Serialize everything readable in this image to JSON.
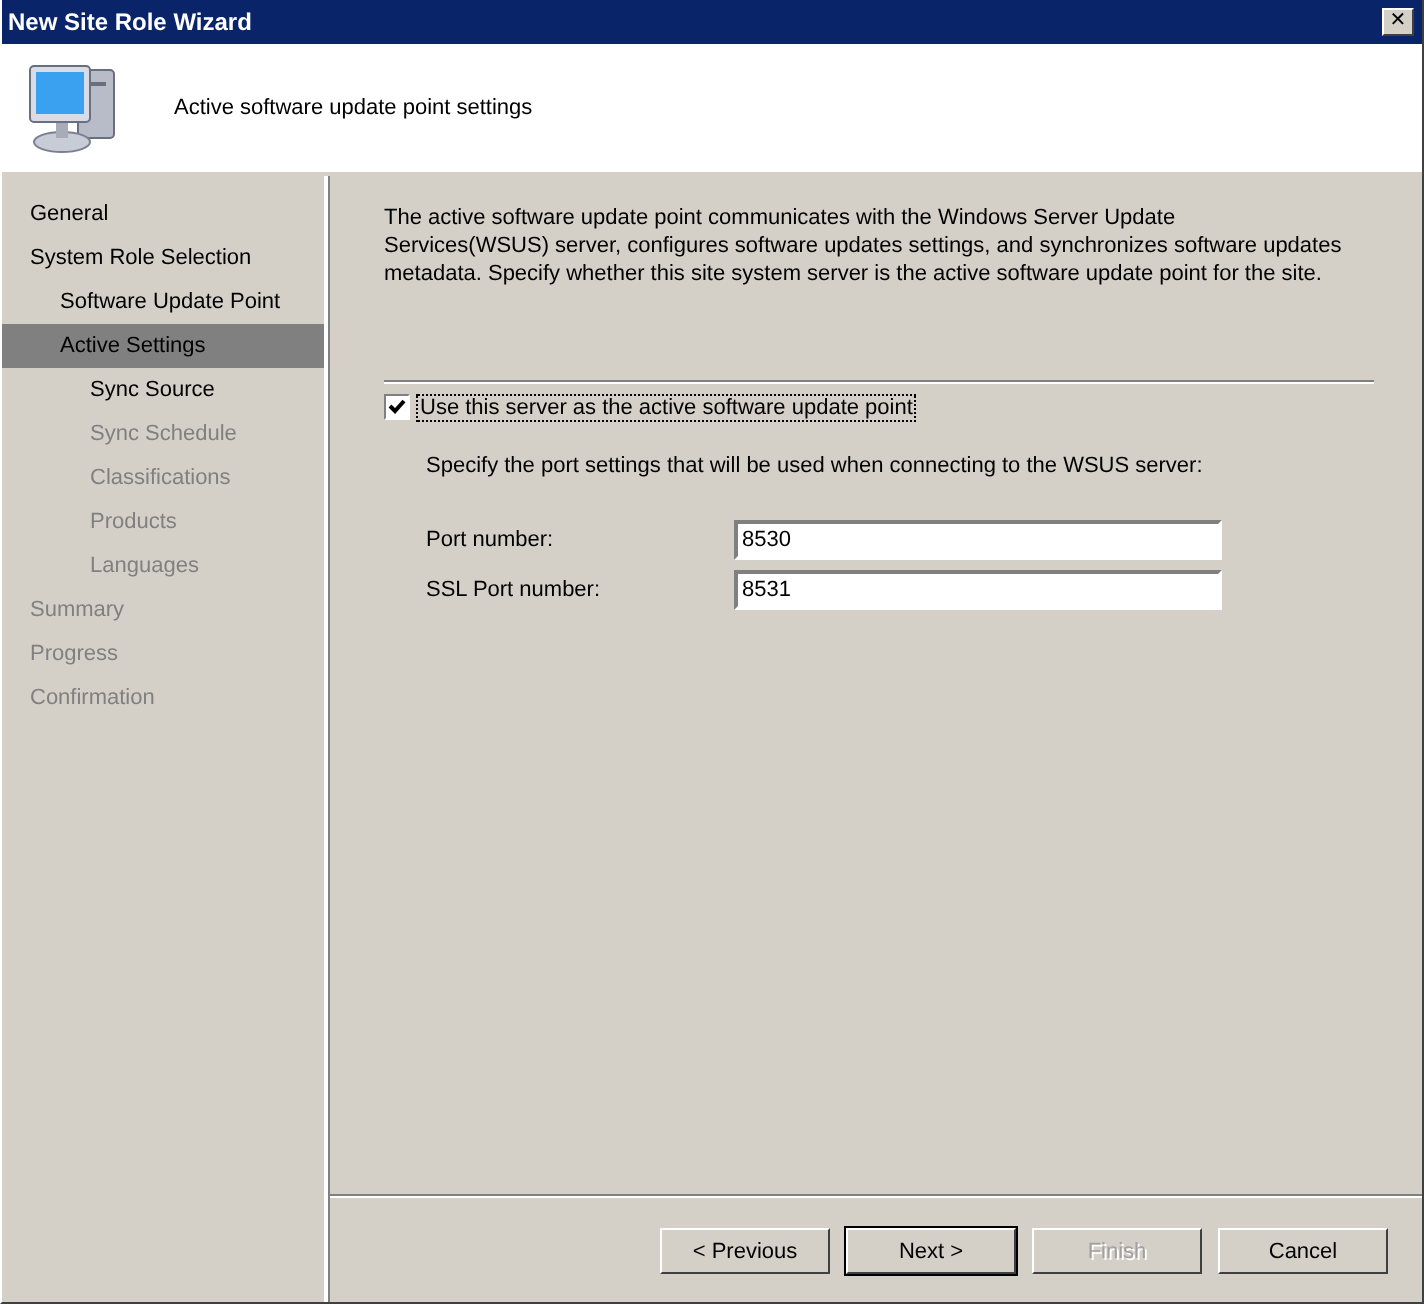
{
  "window": {
    "title": "New Site Role Wizard",
    "close": "✕"
  },
  "header": {
    "title": "Active software update point settings"
  },
  "sidebar": {
    "items": [
      {
        "label": "General",
        "disabled": false,
        "selected": false
      },
      {
        "label": "System Role Selection",
        "disabled": false,
        "selected": false,
        "children": [
          {
            "label": "Software Update Point",
            "disabled": false,
            "selected": false
          },
          {
            "label": "Active Settings",
            "disabled": false,
            "selected": true,
            "children": [
              {
                "label": "Sync Source",
                "disabled": false,
                "selected": false
              },
              {
                "label": "Sync Schedule",
                "disabled": true,
                "selected": false
              },
              {
                "label": "Classifications",
                "disabled": true,
                "selected": false
              },
              {
                "label": "Products",
                "disabled": true,
                "selected": false
              },
              {
                "label": "Languages",
                "disabled": true,
                "selected": false
              }
            ]
          }
        ]
      },
      {
        "label": "Summary",
        "disabled": true,
        "selected": false
      },
      {
        "label": "Progress",
        "disabled": true,
        "selected": false
      },
      {
        "label": "Confirmation",
        "disabled": true,
        "selected": false
      }
    ]
  },
  "content": {
    "description": "The active software update point communicates with the Windows Server Update Services(WSUS) server, configures software updates settings, and synchronizes software updates metadata. Specify whether this site system server is the active software update point for the site.",
    "checkbox": {
      "label": "Use this server as the active software update point",
      "checked": true
    },
    "port_hint": "Specify the port settings that will be used when connecting to the WSUS server:",
    "fields": [
      {
        "label": "Port number:",
        "value": "8530"
      },
      {
        "label": "SSL Port number:",
        "value": "8531"
      }
    ]
  },
  "buttons": [
    {
      "label": "< Previous",
      "default": false,
      "disabled": false
    },
    {
      "label": "Next >",
      "default": true,
      "disabled": false
    },
    {
      "label": "Finish",
      "default": false,
      "disabled": true
    },
    {
      "label": "Cancel",
      "default": false,
      "disabled": false
    }
  ]
}
